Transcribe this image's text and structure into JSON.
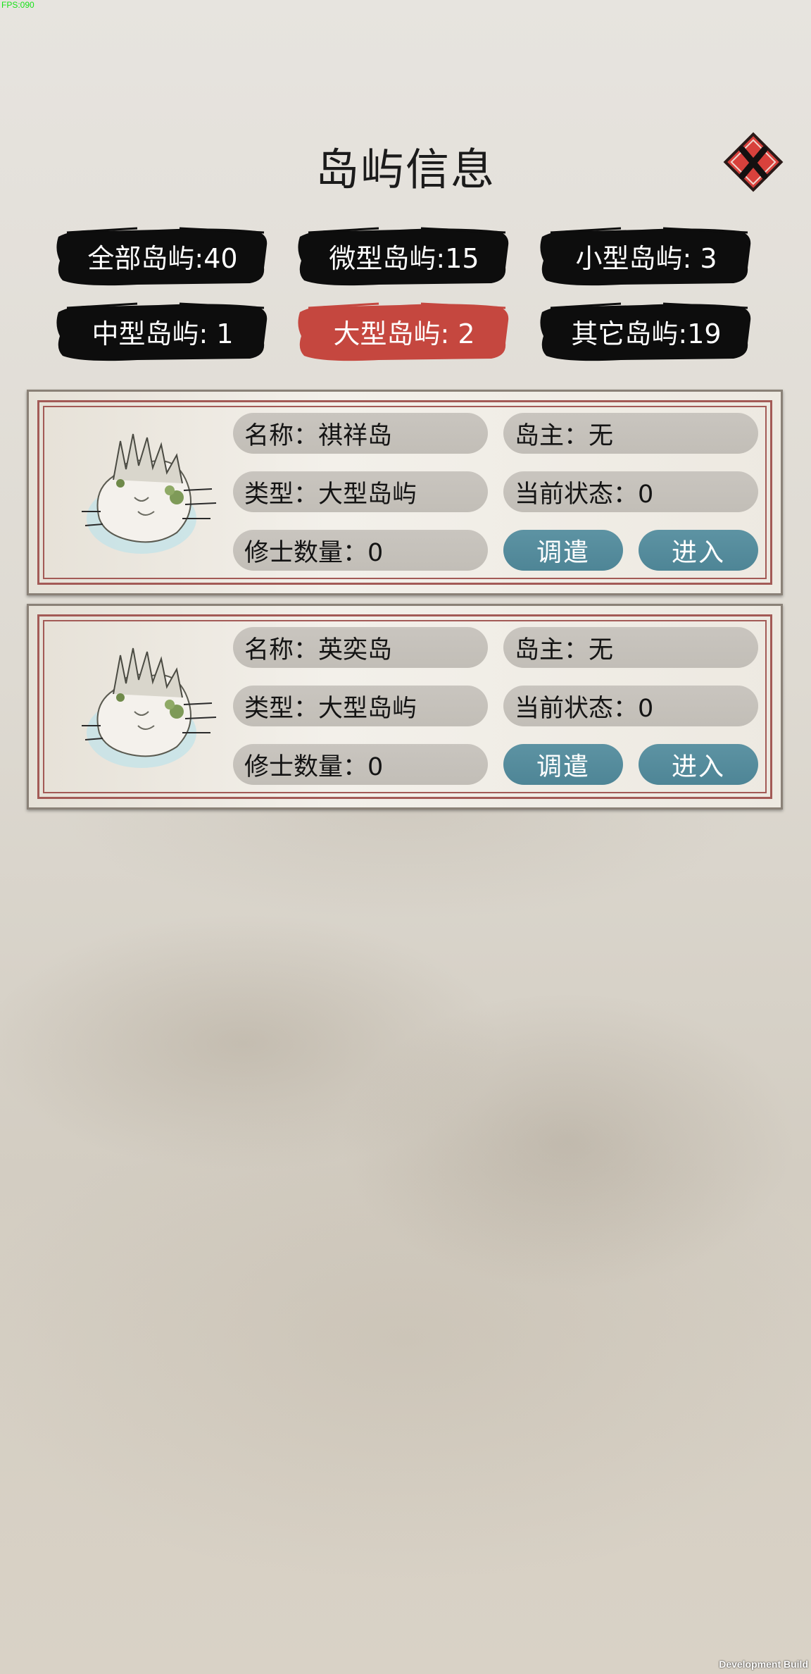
{
  "debug": {
    "fps": "FPS:090",
    "build": "Development Build"
  },
  "title": "岛屿信息",
  "tabs": [
    {
      "label": "全部岛屿:40",
      "active": false
    },
    {
      "label": "微型岛屿:15",
      "active": false
    },
    {
      "label": "小型岛屿: 3",
      "active": false
    },
    {
      "label": "中型岛屿: 1",
      "active": false
    },
    {
      "label": "大型岛屿: 2",
      "active": true
    },
    {
      "label": "其它岛屿:19",
      "active": false
    }
  ],
  "islands": [
    {
      "name": "名称：祺祥岛",
      "owner": "岛主：无",
      "type": "类型：大型岛屿",
      "status": "当前状态：0",
      "cultivators": "修士数量：0",
      "dispatch_label": "调遣",
      "enter_label": "进入"
    },
    {
      "name": "名称：英奕岛",
      "owner": "岛主：无",
      "type": "类型：大型岛屿",
      "status": "当前状态：0",
      "cultivators": "修士数量：0",
      "dispatch_label": "调遣",
      "enter_label": "进入"
    }
  ],
  "colors": {
    "tab_inactive": "#0d0d0d",
    "tab_active": "#c5473f",
    "close_button": "#d8413c",
    "action_button": "#528a9b",
    "frame_line": "#a35a56"
  },
  "icons": {
    "close": "close-x-icon",
    "island": "island-illustration-icon"
  }
}
